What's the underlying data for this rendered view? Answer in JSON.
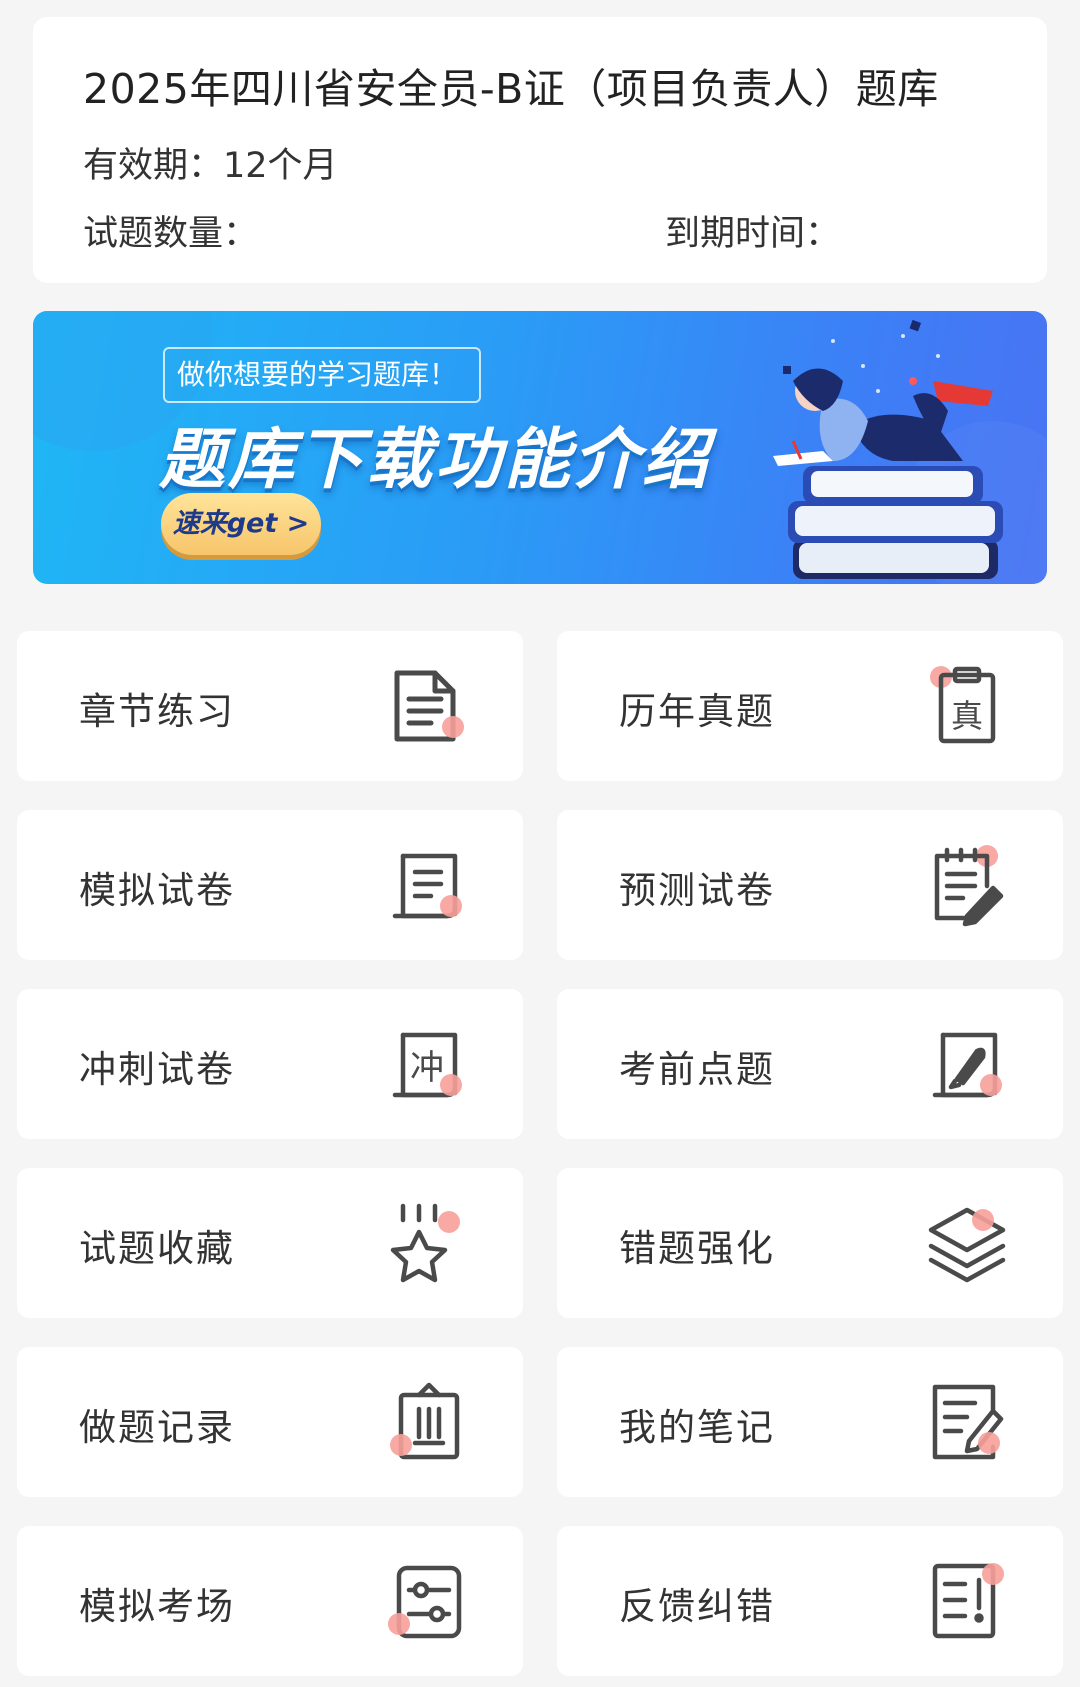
{
  "info": {
    "title": "2025年四川省安全员-B证（项目负责人）题库",
    "validity_label": "有效期：",
    "validity_value": "12个月",
    "count_label": "试题数量：",
    "expire_label": "到期时间："
  },
  "banner": {
    "subtitle": "做你想要的学习题库！",
    "title": "题库下载功能介绍",
    "button": "速来get >"
  },
  "menu": [
    {
      "label": "章节练习",
      "icon": "document-icon"
    },
    {
      "label": "历年真题",
      "icon": "clipboard-zhen-icon"
    },
    {
      "label": "模拟试卷",
      "icon": "scroll-icon"
    },
    {
      "label": "预测试卷",
      "icon": "notepad-pen-icon"
    },
    {
      "label": "冲刺试卷",
      "icon": "scroll-chong-icon"
    },
    {
      "label": "考前点题",
      "icon": "scroll-rocket-icon"
    },
    {
      "label": "试题收藏",
      "icon": "star-icon"
    },
    {
      "label": "错题强化",
      "icon": "layers-icon"
    },
    {
      "label": "做题记录",
      "icon": "clipboard-record-icon"
    },
    {
      "label": "我的笔记",
      "icon": "note-edit-icon"
    },
    {
      "label": "模拟考场",
      "icon": "sliders-icon"
    },
    {
      "label": "反馈纠错",
      "icon": "feedback-icon"
    }
  ],
  "colors": {
    "accent_dot": "#f7a09a",
    "icon_stroke": "#4a4a4a",
    "banner_start": "#1fb7f5",
    "banner_end": "#4a73f2",
    "button": "#f7c56a"
  }
}
